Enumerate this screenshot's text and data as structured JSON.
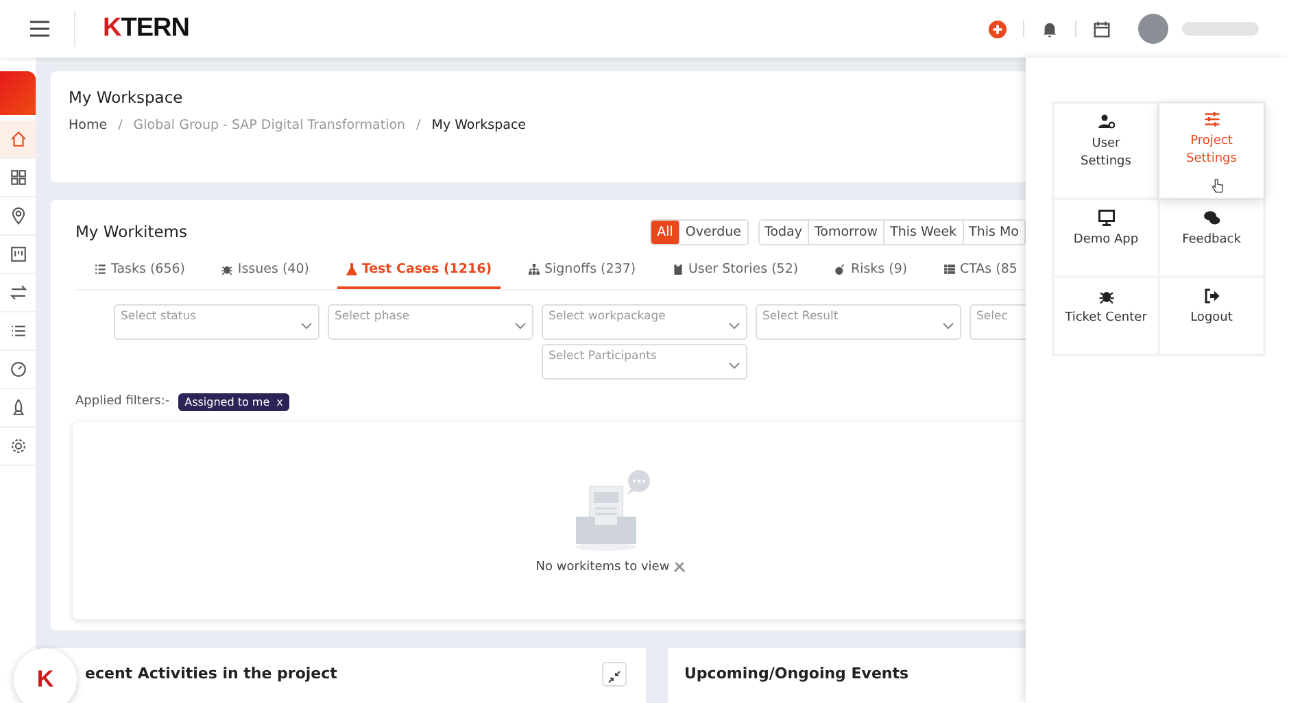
{
  "topbar": {
    "brand_mark": "K",
    "brand_name": "TERN"
  },
  "sidebar": {
    "items": [
      {
        "kind": "home",
        "selected": true
      },
      {
        "kind": "grid",
        "selected": false
      },
      {
        "kind": "pin",
        "selected": false
      },
      {
        "kind": "board",
        "selected": false
      },
      {
        "kind": "swap",
        "selected": false
      },
      {
        "kind": "list",
        "selected": false
      },
      {
        "kind": "gauge",
        "selected": false
      },
      {
        "kind": "rocket",
        "selected": false
      },
      {
        "kind": "gear",
        "selected": false
      }
    ]
  },
  "workspace": {
    "title": "My Workspace",
    "breadcrumb": [
      {
        "label": "Home",
        "current": false
      },
      {
        "label": "Global Group - SAP Digital Transformation",
        "current": false
      },
      {
        "label": "My Workspace",
        "current": true
      }
    ],
    "separator": "/"
  },
  "workitems": {
    "title": "My Workitems",
    "range_buttons": [
      {
        "label": "All",
        "selected": true
      },
      {
        "label": "Overdue",
        "selected": false
      }
    ],
    "date_buttons": [
      {
        "label": "Today",
        "selected": false
      },
      {
        "label": "Tomorrow",
        "selected": false
      },
      {
        "label": "This Week",
        "selected": false
      },
      {
        "label": "This Mo",
        "selected": false
      }
    ],
    "tabs": [
      {
        "kind": "tasks",
        "label": "Tasks (656)",
        "selected": false
      },
      {
        "kind": "issues",
        "label": "Issues (40)",
        "selected": false
      },
      {
        "kind": "testcases",
        "label": "Test Cases (1216)",
        "selected": true
      },
      {
        "kind": "signoffs",
        "label": "Signoffs (237)",
        "selected": false
      },
      {
        "kind": "stories",
        "label": "User Stories (52)",
        "selected": false
      },
      {
        "kind": "risks",
        "label": "Risks (9)",
        "selected": false
      },
      {
        "kind": "ctas",
        "label": "CTAs (85",
        "selected": false
      }
    ],
    "filters": [
      {
        "placeholder": "Select status"
      },
      {
        "placeholder": "Select phase"
      },
      {
        "placeholder": "Select workpackage"
      },
      {
        "placeholder": "Select Result"
      },
      {
        "placeholder": "Selec"
      },
      {
        "placeholder": "Select Participants"
      }
    ],
    "applied_label": "Applied filters:-",
    "applied_chips": [
      {
        "label": "Assigned to me",
        "remove": "x"
      }
    ],
    "empty_message": "No workitems to view"
  },
  "bottom_cards": [
    {
      "title": "ecent Activities in the project",
      "collapsible": true
    },
    {
      "title": "Upcoming/Ongoing Events",
      "collapsible": false
    }
  ],
  "fab": {
    "mark": "K"
  },
  "menu": {
    "tiles": [
      {
        "kind": "user",
        "label": "User\nSettings",
        "selected": false
      },
      {
        "kind": "sliders",
        "label": "Project\nSettings",
        "selected": true
      },
      {
        "kind": "monitor",
        "label": "Demo App",
        "selected": false
      },
      {
        "kind": "chat",
        "label": "Feedback",
        "selected": false
      },
      {
        "kind": "bug",
        "label": "Ticket Center",
        "selected": false
      },
      {
        "kind": "logout",
        "label": "Logout",
        "selected": false
      }
    ]
  }
}
